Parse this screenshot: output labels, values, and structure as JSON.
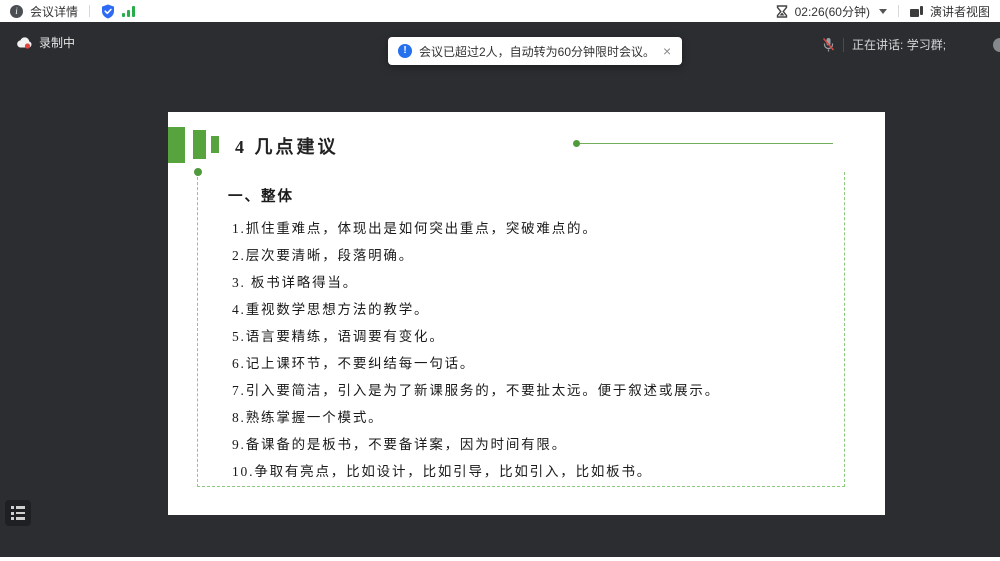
{
  "topbar": {
    "meeting_details_label": "会议详情",
    "timer": "02:26(60分钟)",
    "view_mode_label": "演讲者视图"
  },
  "stage": {
    "recording_label": "录制中",
    "toast": {
      "text": "会议已超过2人，自动转为60分钟限时会议。",
      "close_glyph": "×"
    },
    "speaking": {
      "label": "正在讲话:",
      "name": "学习群;"
    }
  },
  "slide": {
    "title": "4 几点建议",
    "section_heading": "一、整体",
    "items": [
      "1.抓住重难点，体现出是如何突出重点，突破难点的。",
      "2.层次要清晰，段落明确。",
      "3. 板书详略得当。",
      "4.重视数学思想方法的教学。",
      "5.语言要精练，语调要有变化。",
      "6.记上课环节，不要纠结每一句话。",
      "7.引入要简洁，引入是为了新课服务的，不要扯太远。便于叙述或展示。",
      "8.熟练掌握一个模式。",
      "9.备课备的是板书，不要备详案，因为时间有限。",
      "10.争取有亮点，比如设计，比如引导，比如引入，比如板书。"
    ]
  },
  "icons": {
    "info": "i",
    "toast_info": "!"
  },
  "colors": {
    "stage_bg": "#2b2d31",
    "accent_green": "#57a33e",
    "dashed_green": "#8cc87e",
    "toast_blue": "#2470ed",
    "record_red": "#e64340",
    "shield_blue": "#2d6bf5",
    "signal_green": "#27ae4b"
  }
}
